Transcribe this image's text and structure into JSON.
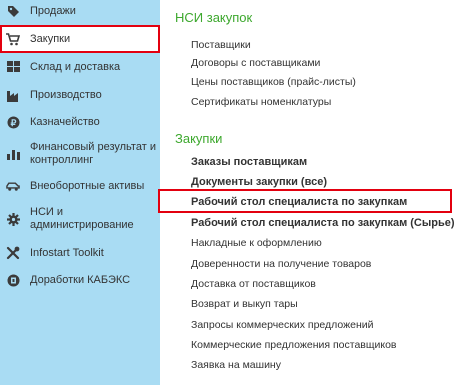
{
  "sidebar": {
    "items": [
      {
        "label": "Продажи",
        "icon": "sales-icon"
      },
      {
        "label": "Закупки",
        "icon": "cart-icon",
        "active": true
      },
      {
        "label": "Склад и доставка",
        "icon": "warehouse-icon"
      },
      {
        "label": "Производство",
        "icon": "factory-icon"
      },
      {
        "label": "Казначейство",
        "icon": "treasury-icon"
      },
      {
        "label": "Финансовый результат и контроллинг",
        "icon": "bar-chart-icon"
      },
      {
        "label": "Внеоборотные активы",
        "icon": "car-icon"
      },
      {
        "label": "НСИ и администрирование",
        "icon": "gear-icon"
      },
      {
        "label": "Infostart Toolkit",
        "icon": "tools-icon"
      },
      {
        "label": "Доработки КАБЭКС",
        "icon": "puzzle-icon"
      }
    ]
  },
  "main": {
    "sections": [
      {
        "title": "НСИ закупок",
        "links": [
          {
            "label": "Поставщики",
            "bold": false
          },
          {
            "label": "Договоры с поставщиками",
            "bold": false
          },
          {
            "label": "Цены поставщиков (прайс-листы)",
            "bold": false
          },
          {
            "label": "Сертификаты номенклатуры",
            "bold": false
          }
        ]
      },
      {
        "title": "Закупки",
        "links": [
          {
            "label": "Заказы поставщикам",
            "bold": true
          },
          {
            "label": "Документы закупки (все)",
            "bold": true
          },
          {
            "label": "Рабочий стол специалиста по закупкам",
            "bold": true,
            "highlighted": true
          },
          {
            "label": "Рабочий стол специалиста по закупкам (Сырье)",
            "bold": true
          },
          {
            "label": "Накладные к оформлению",
            "bold": false
          },
          {
            "label": "Доверенности на получение товаров",
            "bold": false
          },
          {
            "label": "Доставка от поставщиков",
            "bold": false
          },
          {
            "label": "Возврат и выкуп тары",
            "bold": false
          },
          {
            "label": "Запросы коммерческих предложений",
            "bold": false
          },
          {
            "label": "Коммерческие предложения поставщиков",
            "bold": false
          },
          {
            "label": "Заявка на машину",
            "bold": false
          }
        ]
      }
    ]
  },
  "colors": {
    "sidebar_bg": "#a9dcf3",
    "section_title": "#3da82e",
    "highlight_border": "#e3000f",
    "icon_dark": "#3b3b3b"
  }
}
